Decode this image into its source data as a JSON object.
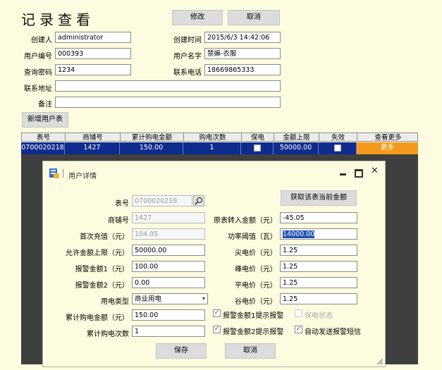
{
  "page": {
    "title": "记录查看",
    "edit_btn": "修改",
    "cancel_btn": "取消"
  },
  "form": {
    "creator_label": "创建人",
    "creator_value": "administrator",
    "created_time_label": "创建时间",
    "created_time_value": "2015/6/3 14:42:06",
    "user_no_label": "用户编号",
    "user_no_value": "000393",
    "user_name_label": "用户名字",
    "user_name_value": "禁嫲-衣服",
    "query_pwd_label": "查询密码",
    "query_pwd_value": "1234",
    "phone_label": "联系电话",
    "phone_value": "18669865333",
    "address_label": "联系地址",
    "address_value": "",
    "remark_label": "备注",
    "remark_value": "",
    "add_meter_btn": "新增用户表"
  },
  "table": {
    "headers": [
      "表号",
      "商铺号",
      "累计购电金额",
      "购电次数",
      "保电",
      "金额上限",
      "失效",
      "查看更多"
    ],
    "row": {
      "meter_no": "0700020218",
      "shop_no": "1427",
      "total_amount": "150.00",
      "count": "1",
      "limit": "50000.00",
      "more": "更多"
    }
  },
  "dialog": {
    "title": "用户详情",
    "get_amount_btn": "获取该表当前金额",
    "meter_no_label": "表号",
    "meter_no_value": "0700020218",
    "shop_no_label": "商铺号",
    "shop_no_value": "1427",
    "first_charge_label": "首次充值（元）",
    "first_charge_value": "104.95",
    "allowed_limit_label": "允许金额上限（元）",
    "allowed_limit_value": "50000.00",
    "alarm1_label": "报警金额1（元）",
    "alarm1_value": "100.00",
    "alarm2_label": "报警金额2（元）",
    "alarm2_value": "0.00",
    "elec_type_label": "用电类型",
    "elec_type_value": "商业用电",
    "total_amount_label": "累计购电金额（元）",
    "total_amount_value": "150.00",
    "total_count_label": "累计购电次数",
    "total_count_value": "1",
    "orig_amount_label": "原表转入金额（元）",
    "orig_amount_value": "-45.05",
    "power_threshold_label": "功率阈值（瓦）",
    "power_threshold_value": "14000.00",
    "sharp_price_label": "尖电价（元）",
    "sharp_price_value": "1.25",
    "peak_price_label": "峰电价（元）",
    "peak_price_value": "1.25",
    "flat_price_label": "平电价（元）",
    "flat_price_value": "1.25",
    "valley_price_label": "谷电价（元）",
    "valley_price_value": "1.25",
    "alarm1_notice": "报警金额1提示报警",
    "alarm2_notice": "报警金额2提示报警",
    "guarantee_status": "保电状态",
    "auto_sms": "自动发送报警短信",
    "save_btn": "保存",
    "cancel_btn": "取消"
  }
}
